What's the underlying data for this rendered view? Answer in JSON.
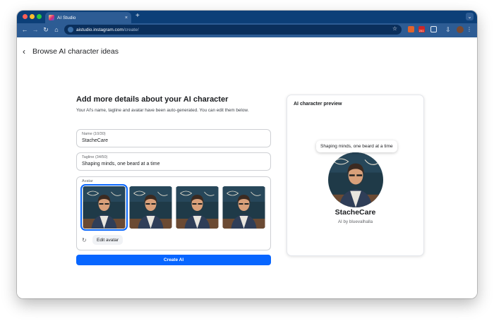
{
  "browser": {
    "tab_title": "AI Studio",
    "tab_close": "×",
    "new_tab": "+",
    "url_host": "aistudio.instagram.com",
    "url_path": "/create/",
    "extension_badge": "241",
    "icons": {
      "back": "arrow-left-icon",
      "forward": "arrow-right-icon",
      "reload": "reload-icon",
      "home": "home-icon",
      "bookmark": "star-icon",
      "download": "download-icon",
      "extensions": "puzzle-icon",
      "menu": "more-vert-icon"
    }
  },
  "header": {
    "back_glyph": "‹",
    "title": "Browse AI character ideas"
  },
  "form": {
    "title": "Add more details about your AI character",
    "subtitle": "Your AI's name, tagline and avatar have been auto-generated. You can edit them below.",
    "name": {
      "label": "Name (10/30)",
      "value": "StacheCare"
    },
    "tagline": {
      "label": "Tagline (34/50)",
      "value": "Shaping minds, one beard at a time"
    },
    "avatar": {
      "label": "Avatar",
      "options": [
        {
          "alt": "avatar-option-1",
          "selected": true
        },
        {
          "alt": "avatar-option-2",
          "selected": false
        },
        {
          "alt": "avatar-option-3",
          "selected": false
        },
        {
          "alt": "avatar-option-4",
          "selected": false
        }
      ],
      "regenerate_glyph": "↻",
      "edit_label": "Edit avatar"
    },
    "create_label": "Create AI"
  },
  "preview": {
    "title": "AI character preview",
    "tagline": "Shaping minds, one beard at a time",
    "name": "StacheCare",
    "by": "AI by bluevalhalla"
  },
  "colors": {
    "chrome": "#0c3f78",
    "toolbar": "#2d5c94",
    "accent": "#0866ff",
    "border": "#ced0d4"
  }
}
